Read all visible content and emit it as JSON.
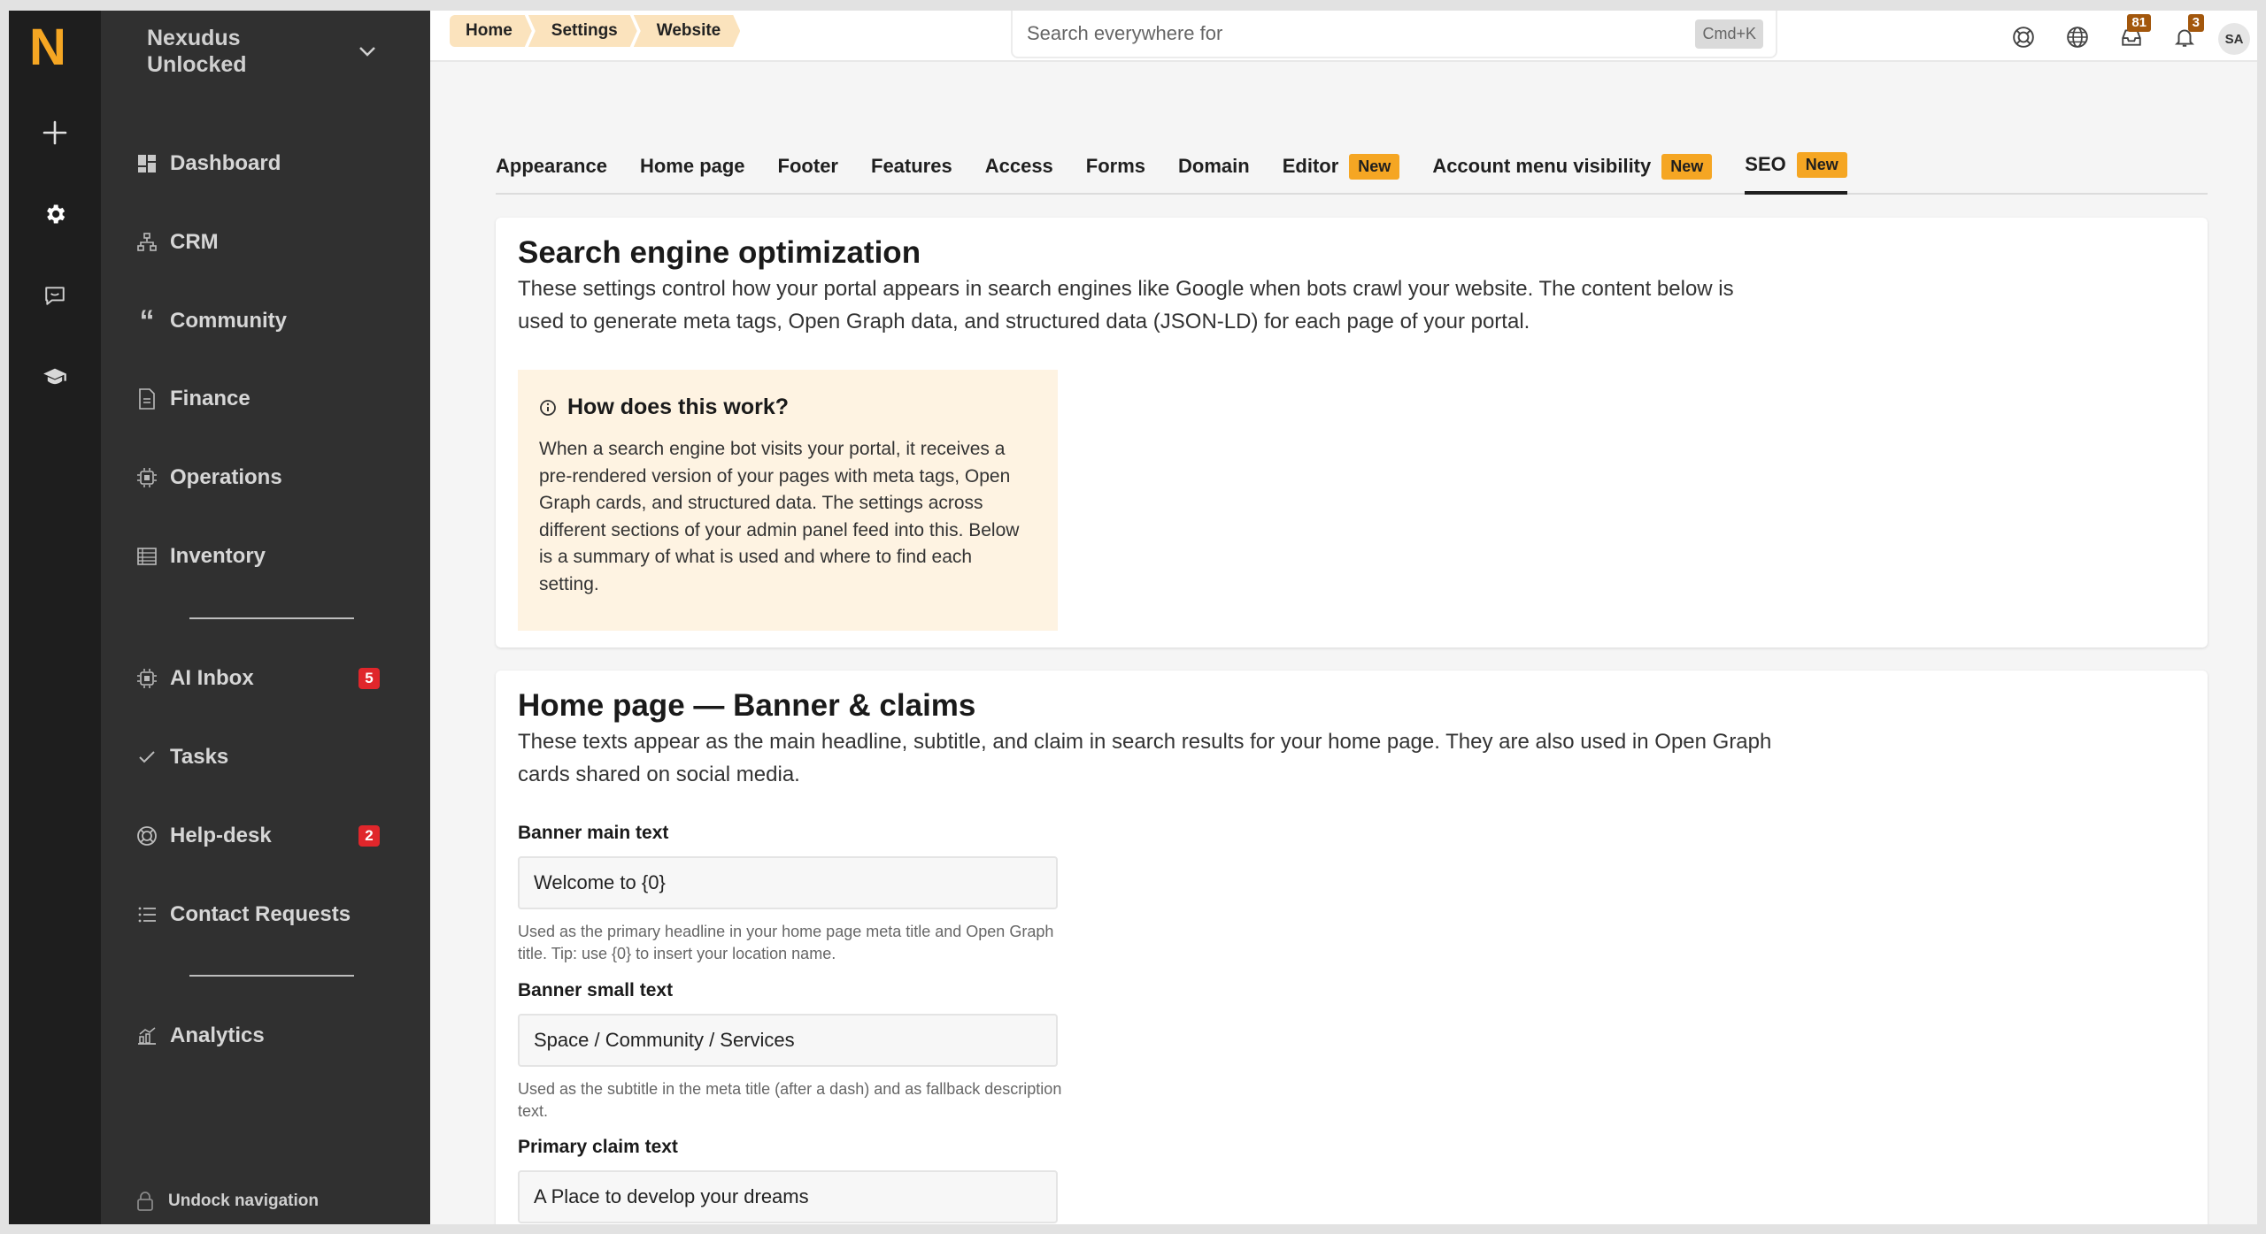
{
  "app": {
    "logo_letter": "N",
    "org_name": "Nexudus Unlocked",
    "accent_color": "#f5a623"
  },
  "sidebar": {
    "items": [
      {
        "label": "Dashboard",
        "icon": "dashboard-icon"
      },
      {
        "label": "CRM",
        "icon": "hierarchy-icon"
      },
      {
        "label": "Community",
        "icon": "quote-icon"
      },
      {
        "label": "Finance",
        "icon": "document-icon"
      },
      {
        "label": "Operations",
        "icon": "chip-icon"
      },
      {
        "label": "Inventory",
        "icon": "list-table-icon"
      },
      {
        "label": "AI Inbox",
        "icon": "chip-icon",
        "badge": "5"
      },
      {
        "label": "Tasks",
        "icon": "check-icon"
      },
      {
        "label": "Help-desk",
        "icon": "lifebuoy-icon",
        "badge": "2"
      },
      {
        "label": "Contact Requests",
        "icon": "list-icon"
      },
      {
        "label": "Analytics",
        "icon": "chart-icon"
      }
    ],
    "undock_label": "Undock navigation"
  },
  "breadcrumb": [
    "Home",
    "Settings",
    "Website"
  ],
  "search": {
    "placeholder": "Search everywhere for",
    "shortcut": "Cmd+K"
  },
  "topbar": {
    "inbox_badge": "81",
    "notifications_badge": "3",
    "avatar_initials": "SA"
  },
  "tabs": [
    {
      "label": "Appearance"
    },
    {
      "label": "Home page"
    },
    {
      "label": "Footer"
    },
    {
      "label": "Features"
    },
    {
      "label": "Access"
    },
    {
      "label": "Forms"
    },
    {
      "label": "Domain"
    },
    {
      "label": "Editor",
      "badge": "New"
    },
    {
      "label": "Account menu visibility",
      "badge": "New"
    },
    {
      "label": "SEO",
      "badge": "New",
      "active": true
    }
  ],
  "seo_card": {
    "title": "Search engine optimization",
    "description": "These settings control how your portal appears in search engines like Google when bots crawl your website. The content below is used to generate meta tags, Open Graph data, and structured data (JSON-LD) for each page of your portal.",
    "info_title": "How does this work?",
    "info_text": "When a search engine bot visits your portal, it receives a pre-rendered version of your pages with meta tags, Open Graph cards, and structured data. The settings across different sections of your admin panel feed into this. Below is a summary of what is used and where to find each setting."
  },
  "home_card": {
    "title": "Home page — Banner & claims",
    "description": "These texts appear as the main headline, subtitle, and claim in search results for your home page. They are also used in Open Graph cards shared on social media.",
    "fields": [
      {
        "label": "Banner main text",
        "value": "Welcome to {0}",
        "help": "Used as the primary headline in your home page meta title and Open Graph title. Tip: use {0} to insert your location name."
      },
      {
        "label": "Banner small text",
        "value": "Space / Community / Services",
        "help": "Used as the subtitle in the meta title (after a dash) and as fallback description text."
      },
      {
        "label": "Primary claim text",
        "value": "A Place to develop your dreams"
      }
    ]
  }
}
